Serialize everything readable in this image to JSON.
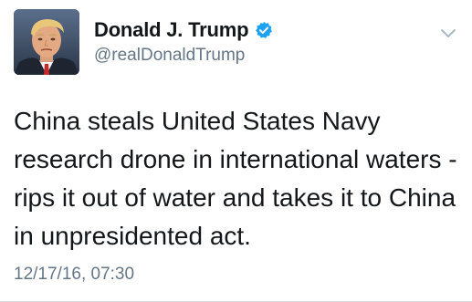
{
  "author": {
    "display_name": "Donald J. Trump",
    "handle": "@realDonaldTrump",
    "verified": true,
    "verified_icon": "verified-badge-icon",
    "avatar_icon": "profile-photo"
  },
  "tweet": {
    "text": "China steals United States Navy\nresearch drone in international waters -\nrips it out of water and takes it to China\nin unpresidented act.",
    "timestamp": "12/17/16, 07:30"
  },
  "menu": {
    "icon": "chevron-down-icon"
  },
  "colors": {
    "name": "#14171a",
    "secondary": "#657786",
    "verified": "#1da1f2",
    "chevron": "#aab8c2"
  }
}
